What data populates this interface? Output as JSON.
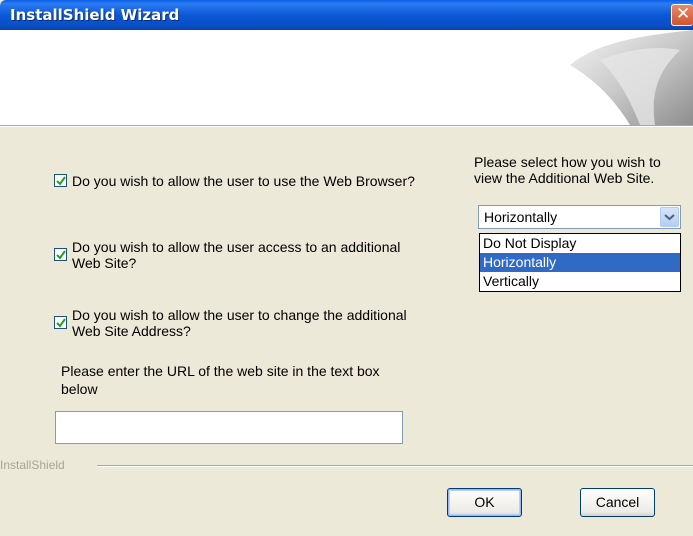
{
  "window": {
    "title": "InstallShield Wizard"
  },
  "options": {
    "allow_browser": {
      "label": "Do you wish to allow the user to use the Web Browser?",
      "checked": true
    },
    "allow_additional_site": {
      "label_line1": "Do you wish to allow the user access to an additional",
      "label_line2": "Web Site?",
      "checked": true
    },
    "allow_change_address": {
      "label_line1": "Do you wish to allow the user to change the additional",
      "label_line2": "Web Site Address?",
      "checked": true
    }
  },
  "url_prompt": {
    "line1": "Please enter the URL of the web site in the text box",
    "line2": "below",
    "value": ""
  },
  "view_select": {
    "prompt_line1": "Please select how you wish to",
    "prompt_line2": "view the Additional Web Site.",
    "selected": "Horizontally",
    "options": [
      "Do Not Display",
      "Horizontally",
      "Vertically"
    ]
  },
  "footer": {
    "brand": "InstallShield",
    "ok_label": "OK",
    "cancel_label": "Cancel"
  },
  "colors": {
    "title_bar": "#0A5FE4",
    "dialog_bg": "#ECE9D8",
    "selection": "#316AC5",
    "close": "#D3532E"
  }
}
